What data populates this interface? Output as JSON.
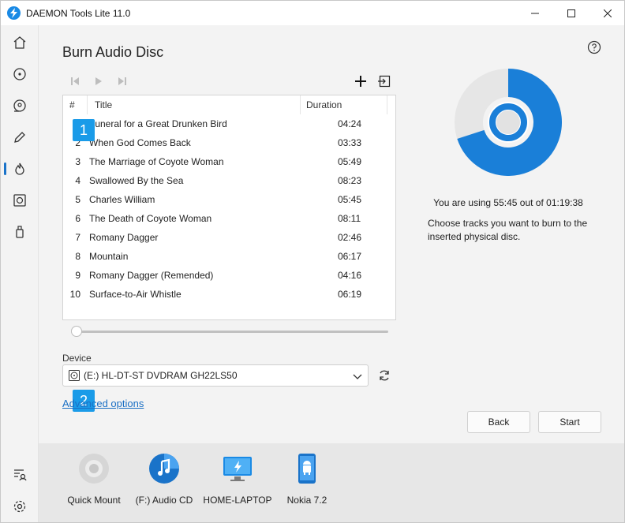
{
  "window": {
    "title": "DAEMON Tools Lite 11.0"
  },
  "sidebar": {
    "items": [
      {
        "name": "home-icon"
      },
      {
        "name": "disc-icon"
      },
      {
        "name": "images-icon"
      },
      {
        "name": "editor-icon"
      },
      {
        "name": "burn-icon",
        "active": true
      },
      {
        "name": "imaging-icon"
      },
      {
        "name": "usb-icon"
      }
    ],
    "bottom": [
      {
        "name": "license-icon"
      },
      {
        "name": "settings-icon"
      }
    ]
  },
  "page": {
    "title": "Burn Audio Disc",
    "table": {
      "headers": {
        "num": "#",
        "title": "Title",
        "duration": "Duration"
      },
      "rows": [
        {
          "num": "1",
          "title": "Funeral for a Great Drunken Bird",
          "duration": "04:24"
        },
        {
          "num": "2",
          "title": "When God Comes Back",
          "duration": "03:33"
        },
        {
          "num": "3",
          "title": "The Marriage of Coyote Woman",
          "duration": "05:49"
        },
        {
          "num": "4",
          "title": "Swallowed By the Sea",
          "duration": "08:23"
        },
        {
          "num": "5",
          "title": "Charles William",
          "duration": "05:45"
        },
        {
          "num": "6",
          "title": "The Death of Coyote Woman",
          "duration": "08:11"
        },
        {
          "num": "7",
          "title": "Romany Dagger",
          "duration": "02:46"
        },
        {
          "num": "8",
          "title": "Mountain",
          "duration": "06:17"
        },
        {
          "num": "9",
          "title": "Romany Dagger (Remended)",
          "duration": "04:16"
        },
        {
          "num": "10",
          "title": "Surface-to-Air Whistle",
          "duration": "06:19"
        }
      ]
    },
    "playback_position": 0,
    "device_label": "Device",
    "device_value": "(E:) HL-DT-ST DVDRAM GH22LS50",
    "advanced_link": "Advanced options",
    "back_label": "Back",
    "start_label": "Start",
    "badges": [
      "1",
      "2"
    ],
    "usage_text": "You are using 55:45 out of 01:19:38",
    "hint_text": "Choose tracks you want to burn to the inserted physical disc.",
    "usage_fraction": 0.7,
    "accent_color": "#1a7fd8"
  },
  "devices": [
    {
      "name": "quick-mount",
      "label": "Quick Mount",
      "icon": "quick-mount-icon"
    },
    {
      "name": "audio-cd",
      "label": "(F:) Audio CD",
      "icon": "music-disc-icon"
    },
    {
      "name": "home-laptop",
      "label": "HOME-LAPTOP",
      "icon": "monitor-icon"
    },
    {
      "name": "nokia",
      "label": "Nokia 7.2",
      "icon": "android-phone-icon"
    }
  ]
}
